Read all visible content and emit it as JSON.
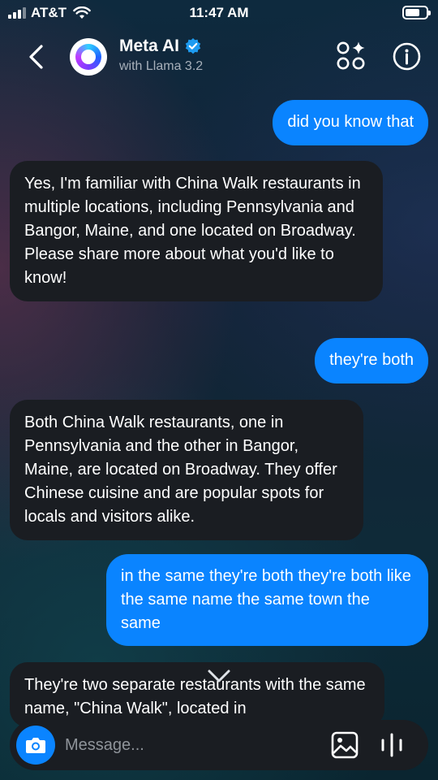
{
  "status_bar": {
    "carrier": "AT&T",
    "time": "11:47 AM",
    "battery_level": 0.7
  },
  "header": {
    "title": "Meta AI",
    "subtitle": "with Llama 3.2",
    "icons": [
      "back-chevron-icon",
      "meta-ai-avatar",
      "verified-badge-icon",
      "apps-sparkle-icon",
      "info-icon"
    ]
  },
  "messages": [
    {
      "sender": "user",
      "text": "did you know that"
    },
    {
      "sender": "bot",
      "text": "Yes, I'm familiar with China Walk restaurants in multiple locations, including Pennsylvania and Bangor, Maine, and one located on Broadway. Please share more about what you'd like to know!"
    },
    {
      "sender": "user",
      "text": "they're both"
    },
    {
      "sender": "bot",
      "text": "Both China Walk restaurants, one in Pennsylvania and the other in Bangor, Maine, are located on Broadway. They offer Chinese cuisine and are popular spots for locals and visitors alike."
    },
    {
      "sender": "user",
      "text": "in the same they're both they're both like the same name the same town the same"
    },
    {
      "sender": "bot",
      "text": "They're two separate restaurants with the same name, \"China Walk\", located in"
    }
  ],
  "composer": {
    "placeholder": "Message...",
    "value": "",
    "icons": [
      "camera-icon",
      "gallery-icon",
      "voice-icon"
    ]
  },
  "colors": {
    "user_bubble": "#0a84ff",
    "bot_bubble": "#1a1d22",
    "verified": "#1d9bf0"
  }
}
